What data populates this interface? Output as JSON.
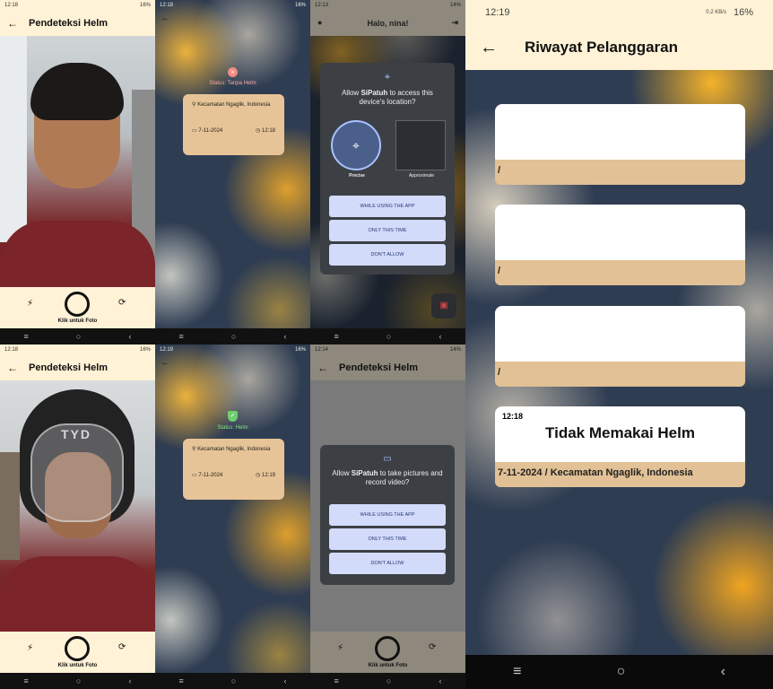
{
  "panel1": {
    "status_time": "12:18",
    "status_right": "16%",
    "title": "Pendeteksi Helm",
    "capture_label": "Klik untuk Foto"
  },
  "panel2": {
    "status_time": "12:18",
    "status_right": "16%",
    "status_text": "Status: Tanpa Helm",
    "location": "Kecamatan Ngaglik, Indonesia",
    "date": "7-11-2024",
    "time": "12:18"
  },
  "panel3": {
    "status_time": "12:13",
    "status_right": "14%",
    "greeting": "Halo, nina!",
    "dialog_prefix": "Allow ",
    "dialog_app": "SiPatuh",
    "dialog_rest": " to access this device's location?",
    "precise": "Precise",
    "approximate": "Approximate",
    "btn1": "WHILE USING THE APP",
    "btn2": "ONLY THIS TIME",
    "btn3": "DON'T ALLOW"
  },
  "panel4": {
    "status_time": "12:18",
    "status_right": "16%",
    "title": "Pendeteksi Helm",
    "capture_label": "Klik untuk Foto",
    "helmet_text": "TYD"
  },
  "panel5": {
    "status_time": "12:19",
    "status_right": "16%",
    "status_text": "Status: Helm",
    "location": "Kecamatan Ngaglik, Indonesia",
    "date": "7-11-2024",
    "time": "12:19"
  },
  "panel6": {
    "status_time": "12:14",
    "status_right": "14%",
    "title": "Pendeteksi Helm",
    "dialog_prefix": "Allow ",
    "dialog_app": "SiPatuh",
    "dialog_rest": " to take pictures and record video?",
    "btn1": "WHILE USING THE APP",
    "btn2": "ONLY THIS TIME",
    "btn3": "DON'T ALLOW",
    "capture_label": "Klik untuk Foto"
  },
  "panel7": {
    "status_time": "12:19",
    "status_right": "16%",
    "status_speed": "0.2 KB/s",
    "title": "Riwayat Pelanggaran",
    "cards": [
      {
        "time": "",
        "headline": "",
        "footer": "/"
      },
      {
        "time": "",
        "headline": "",
        "footer": "/"
      },
      {
        "time": "",
        "headline": "",
        "footer": "/"
      },
      {
        "time": "12:18",
        "headline": "Tidak Memakai Helm",
        "footer": "7-11-2024 / Kecamatan Ngaglik, Indonesia"
      }
    ]
  },
  "colors": {
    "cream": "#fff2d6",
    "card_tan": "#e1c195",
    "dialog_btn": "#d3dbfb",
    "red_status": "#f28b82",
    "green_status": "#6ecf6e"
  }
}
